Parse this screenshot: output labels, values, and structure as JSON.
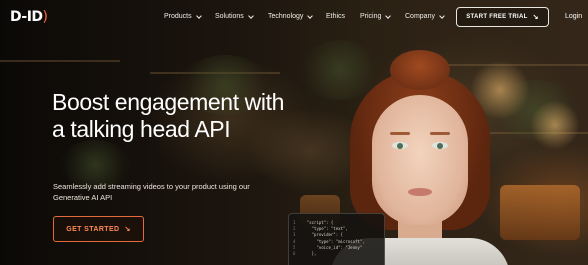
{
  "nav": {
    "logo_text": "D-ID",
    "logo_paren": ")",
    "items": [
      {
        "label": "Products",
        "has_dropdown": true
      },
      {
        "label": "Solutions",
        "has_dropdown": true
      },
      {
        "label": "Technology",
        "has_dropdown": true
      },
      {
        "label": "Ethics",
        "has_dropdown": false
      },
      {
        "label": "Pricing",
        "has_dropdown": true
      },
      {
        "label": "Company",
        "has_dropdown": true
      }
    ],
    "trial_button": "START FREE TRIAL",
    "trial_icon": "arrow-down-right-icon",
    "login": "Login"
  },
  "hero": {
    "headline": "Boost engagement with a talking head API",
    "subtext": "Seamlessly add streaming videos to your product using our Generative AI API",
    "cta": "GET STARTED",
    "cta_icon": "arrow-down-right-icon"
  },
  "code_panel": {
    "lines": [
      {
        "num": "1",
        "text": "  \"script\": {"
      },
      {
        "num": "2",
        "text": "    \"type\": \"text\","
      },
      {
        "num": "3",
        "text": "    \"provider\": {"
      },
      {
        "num": "4",
        "text": "      \"type\": \"microsoft\","
      },
      {
        "num": "5",
        "text": "      \"voice_id\": \"Jenny\""
      },
      {
        "num": "6",
        "text": "    },"
      }
    ]
  },
  "colors": {
    "accent": "#ff6a3d",
    "cta_text": "#ff8a55",
    "background": "#0d0a08"
  }
}
